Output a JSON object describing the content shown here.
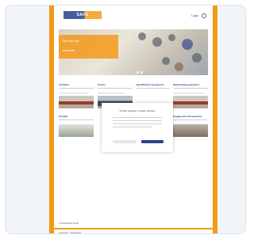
{
  "header": {
    "logo_text": "SAFE",
    "nav_language": "Login",
    "search_icon": "search-icon"
  },
  "hero": {
    "line1": "We care for",
    "line2": "students"
  },
  "columns": [
    {
      "title": "Aktuelles"
    },
    {
      "title": "Events"
    },
    {
      "title": "Qualifikationsprogramm"
    },
    {
      "title": "Weiterbildungsangebot"
    }
  ],
  "second_row": [
    {
      "title": "Kontakt"
    },
    {
      "title": "Engagement Kooperation"
    }
  ],
  "modal": {
    "title": "Privacy Settings / Cookie Hinweis"
  },
  "footer": {
    "line1": "© 2024 Holding GmbH",
    "line2": "Impressum · Datenschutz"
  },
  "colors": {
    "accent": "#f39a17",
    "brand": "#2b3f8c"
  }
}
